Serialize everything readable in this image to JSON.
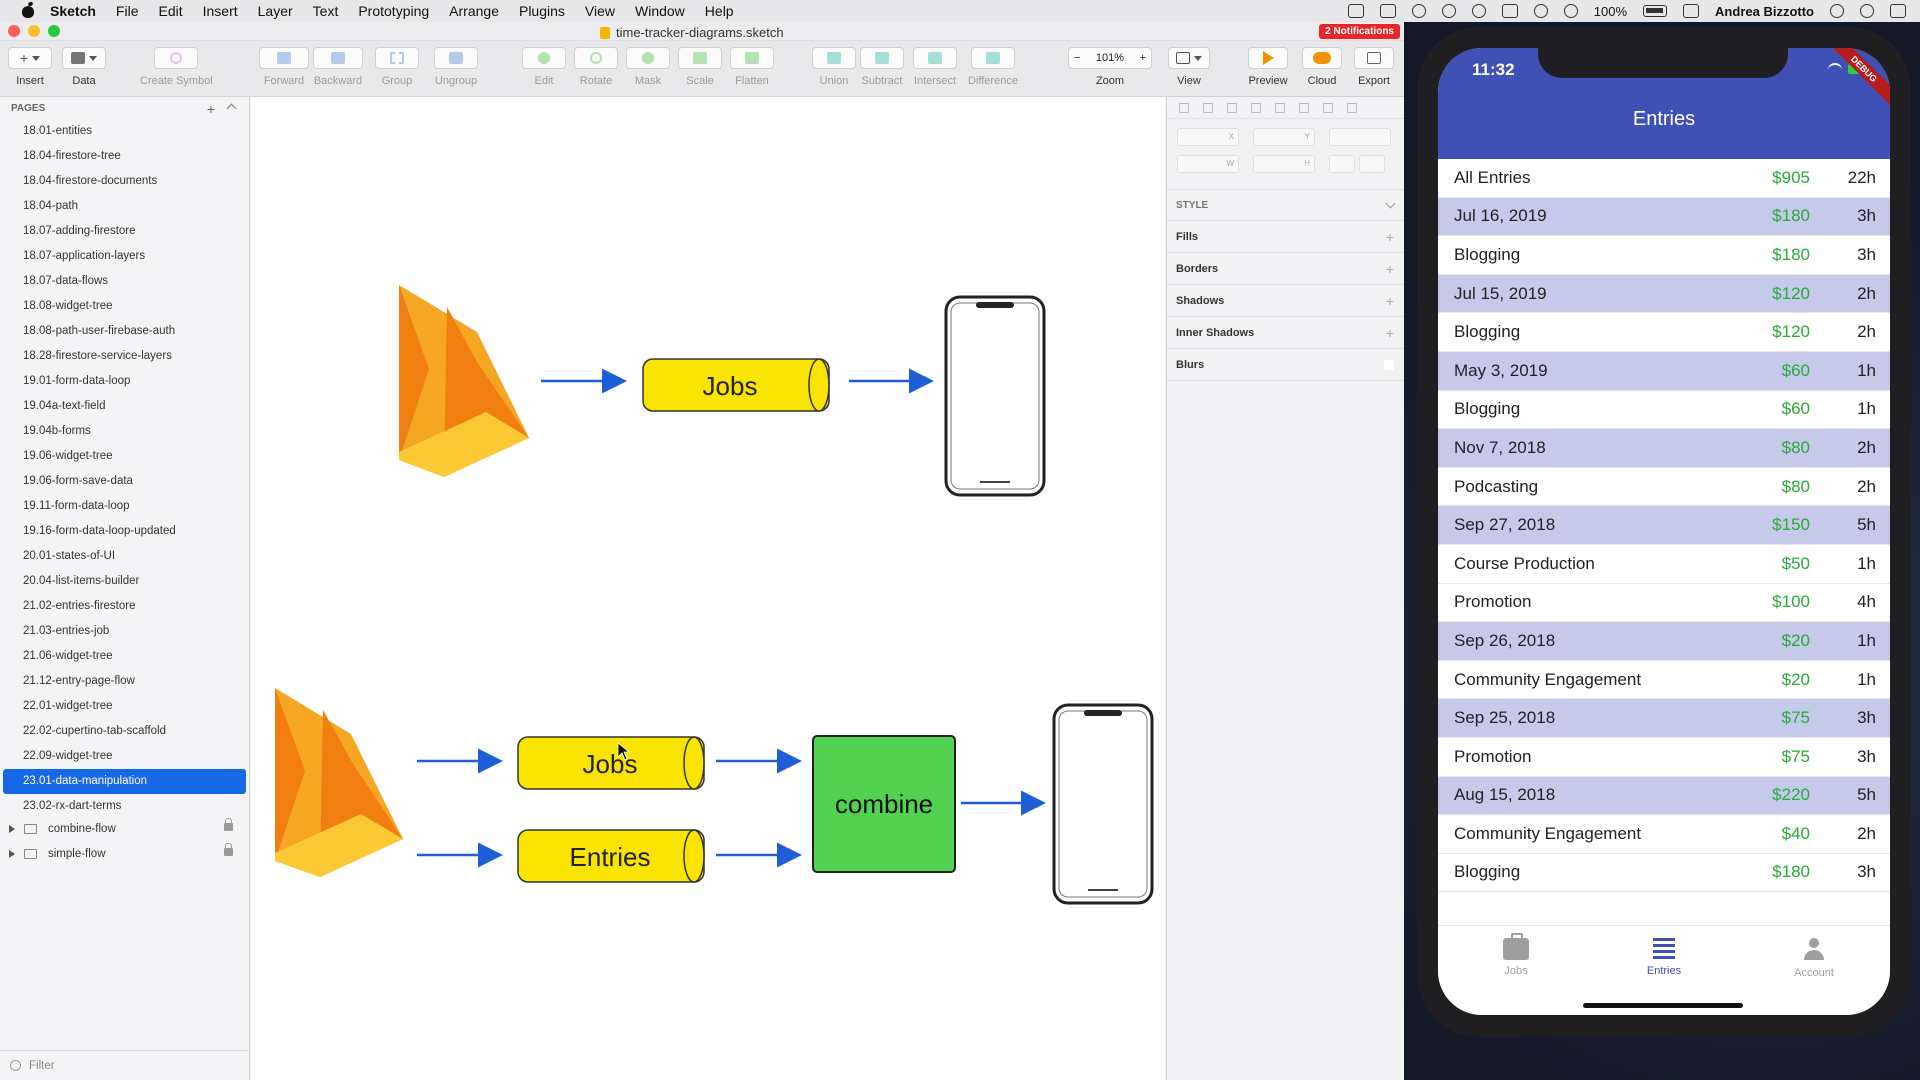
{
  "menubar": {
    "items": [
      "Sketch",
      "File",
      "Edit",
      "Insert",
      "Layer",
      "Text",
      "Prototyping",
      "Arrange",
      "Plugins",
      "View",
      "Window",
      "Help"
    ],
    "battery": "100%",
    "user": "Andrea Bizzotto"
  },
  "window": {
    "title": "time-tracker-diagrams.sketch",
    "notification": "2 Notifications"
  },
  "toolbar": {
    "insert": "Insert",
    "data": "Data",
    "create_symbol": "Create Symbol",
    "forward": "Forward",
    "backward": "Backward",
    "group": "Group",
    "ungroup": "Ungroup",
    "edit": "Edit",
    "rotate": "Rotate",
    "mask": "Mask",
    "scale": "Scale",
    "flatten": "Flatten",
    "union": "Union",
    "subtract": "Subtract",
    "intersect": "Intersect",
    "difference": "Difference",
    "zoom_value": "101%",
    "zoom": "Zoom",
    "view": "View",
    "preview": "Preview",
    "cloud": "Cloud",
    "export": "Export"
  },
  "pages": {
    "header": "PAGES",
    "items": [
      "18.01-entities",
      "18.04-firestore-tree",
      "18.04-firestore-documents",
      "18.04-path",
      "18.07-adding-firestore",
      "18.07-application-layers",
      "18.07-data-flows",
      "18.08-widget-tree",
      "18.08-path-user-firebase-auth",
      "18.28-firestore-service-layers",
      "19.01-form-data-loop",
      "19.04a-text-field",
      "19.04b-forms",
      "19.06-widget-tree",
      "19.06-form-save-data",
      "19.11-form-data-loop",
      "19.16-form-data-loop-updated",
      "20.01-states-of-UI",
      "20.04-list-items-builder",
      "21.02-entries-firestore",
      "21.03-entries-job",
      "21.06-widget-tree",
      "21.12-entry-page-flow",
      "22.01-widget-tree",
      "22.02-cupertino-tab-scaffold",
      "22.09-widget-tree",
      "23.01-data-manipulation",
      "23.02-rx-dart-terms"
    ],
    "selected_index": 26,
    "layers": [
      "combine-flow",
      "simple-flow"
    ],
    "filter": "Filter"
  },
  "canvas": {
    "top_stream": "Jobs",
    "bottom_streams": [
      "Jobs",
      "Entries"
    ],
    "combine": "combine",
    "colors": {
      "stream": "#f9e400",
      "combine": "#52d04f",
      "arrow": "#1e5fd8"
    }
  },
  "inspector": {
    "fields": [
      "X",
      "Y",
      "W",
      "H"
    ],
    "style": "STYLE",
    "sections": [
      "Fills",
      "Borders",
      "Shadows",
      "Inner Shadows",
      "Blurs"
    ]
  },
  "phone": {
    "time": "11:32",
    "debug": "DEBUG",
    "title": "Entries",
    "entries": [
      {
        "name": "All Entries",
        "amount": "$905",
        "hours": "22h",
        "type": "total"
      },
      {
        "name": "Jul 16, 2019",
        "amount": "$180",
        "hours": "3h",
        "type": "date"
      },
      {
        "name": "Blogging",
        "amount": "$180",
        "hours": "3h",
        "type": "job"
      },
      {
        "name": "Jul 15, 2019",
        "amount": "$120",
        "hours": "2h",
        "type": "date"
      },
      {
        "name": "Blogging",
        "amount": "$120",
        "hours": "2h",
        "type": "job"
      },
      {
        "name": "May 3, 2019",
        "amount": "$60",
        "hours": "1h",
        "type": "date"
      },
      {
        "name": "Blogging",
        "amount": "$60",
        "hours": "1h",
        "type": "job"
      },
      {
        "name": "Nov 7, 2018",
        "amount": "$80",
        "hours": "2h",
        "type": "date"
      },
      {
        "name": "Podcasting",
        "amount": "$80",
        "hours": "2h",
        "type": "job"
      },
      {
        "name": "Sep 27, 2018",
        "amount": "$150",
        "hours": "5h",
        "type": "date"
      },
      {
        "name": "Course Production",
        "amount": "$50",
        "hours": "1h",
        "type": "job"
      },
      {
        "name": "Promotion",
        "amount": "$100",
        "hours": "4h",
        "type": "job"
      },
      {
        "name": "Sep 26, 2018",
        "amount": "$20",
        "hours": "1h",
        "type": "date"
      },
      {
        "name": "Community Engagement",
        "amount": "$20",
        "hours": "1h",
        "type": "job"
      },
      {
        "name": "Sep 25, 2018",
        "amount": "$75",
        "hours": "3h",
        "type": "date"
      },
      {
        "name": "Promotion",
        "amount": "$75",
        "hours": "3h",
        "type": "job"
      },
      {
        "name": "Aug 15, 2018",
        "amount": "$220",
        "hours": "5h",
        "type": "date"
      },
      {
        "name": "Community Engagement",
        "amount": "$40",
        "hours": "2h",
        "type": "job"
      },
      {
        "name": "Blogging",
        "amount": "$180",
        "hours": "3h",
        "type": "job"
      }
    ],
    "tabs": [
      {
        "label": "Jobs",
        "icon": "briefcase-icon",
        "active": false
      },
      {
        "label": "Entries",
        "icon": "list-icon",
        "active": true
      },
      {
        "label": "Account",
        "icon": "person-icon",
        "active": false
      }
    ]
  }
}
